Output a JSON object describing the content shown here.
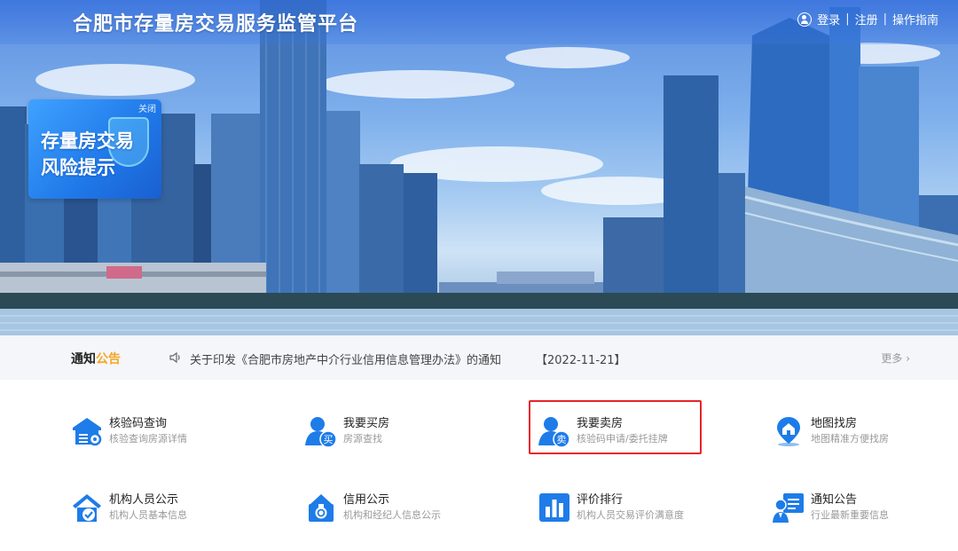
{
  "header": {
    "site_title": "合肥市存量房交易服务监管平台",
    "login": "登录",
    "register": "注册",
    "guide": "操作指南",
    "separator": "|"
  },
  "risk_popup": {
    "close_label": "关闭",
    "line1": "存量房交易",
    "line2": "风险提示"
  },
  "notice": {
    "title_main": "通知",
    "title_accent": "公告",
    "text": "关于印发《合肥市房地产中介行业信用信息管理办法》的通知",
    "date": "【2022-11-21】",
    "more": "更多 ›"
  },
  "services": [
    {
      "name": "核验码查询",
      "desc": "核验查询房源详情",
      "icon": "house-search-icon"
    },
    {
      "name": "我要买房",
      "desc": "房源查找",
      "icon": "buy-user-icon",
      "badge": "买"
    },
    {
      "name": "我要卖房",
      "desc": "核验码申请/委托挂牌",
      "icon": "sell-user-icon",
      "badge": "卖"
    },
    {
      "name": "地图找房",
      "desc": "地图精准方便找房",
      "icon": "map-pin-icon"
    },
    {
      "name": "机构人员公示",
      "desc": "机构人员基本信息",
      "icon": "house-check-icon"
    },
    {
      "name": "信用公示",
      "desc": "机构和经纪人信息公示",
      "icon": "credit-medal-icon"
    },
    {
      "name": "评价排行",
      "desc": "机构人员交易评价满意度",
      "icon": "bar-chart-icon"
    },
    {
      "name": "通知公告",
      "desc": "行业最新重要信息",
      "icon": "notice-board-icon"
    }
  ],
  "colors": {
    "brand_blue": "#1e7ce8",
    "accent_orange": "#f5a623",
    "highlight_red": "#e8222a"
  }
}
